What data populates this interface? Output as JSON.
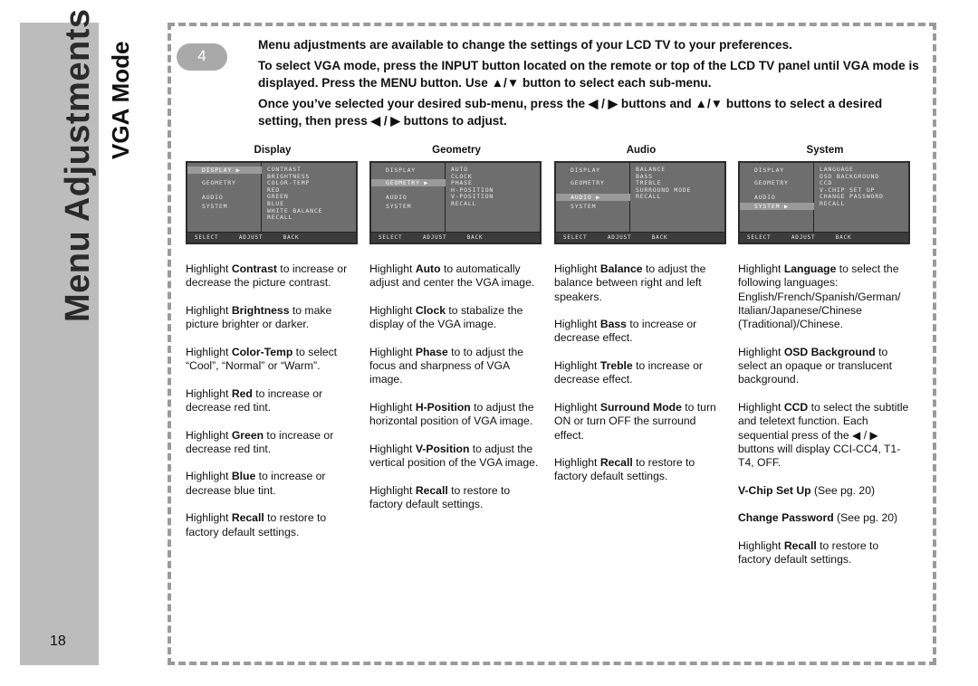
{
  "sidebar": {
    "title": "Menu Adjustments",
    "page_number": "18"
  },
  "section_title": "VGA Mode",
  "step": "4",
  "intro": [
    "Menu adjustments are available to change the settings of your LCD TV to your preferences.",
    "To select VGA mode, press the INPUT button located on the remote or top of the LCD TV panel until VGA mode is displayed. Press the MENU button. Use ▲/▼ button to select each sub-menu.",
    "Once you’ve selected your desired sub-menu, press the ◀ / ▶ buttons and ▲/▼ buttons to select a desired setting, then press ◀ / ▶ buttons to adjust."
  ],
  "osd_main": [
    "DISPLAY",
    "GEOMETRY",
    "AUDIO",
    "SYSTEM"
  ],
  "osd_footer": "SELECT ADJUST BACK",
  "columns": [
    {
      "title": "Display",
      "selected": 0,
      "items": [
        "CONTRAST",
        "BRIGHTNESS",
        "COLOR-TEMP",
        "RED",
        "GREEN",
        "BLUE",
        "WHITE BALANCE",
        "RECALL"
      ],
      "paras": [
        [
          "Highlight ",
          "Contrast",
          " to increase or decrease the picture contrast."
        ],
        [
          "Highlight ",
          "Brightness",
          " to make picture brighter or darker."
        ],
        [
          "Highlight ",
          "Color-Temp",
          " to select “Cool”, “Normal” or “Warm”."
        ],
        [
          "Highlight ",
          "Red",
          " to increase or decrease red tint."
        ],
        [
          "Highlight ",
          "Green",
          " to increase or decrease red tint."
        ],
        [
          "Highlight ",
          "Blue",
          " to increase or decrease blue tint."
        ],
        [
          "Highlight ",
          "Recall",
          " to restore to factory default settings."
        ]
      ]
    },
    {
      "title": "Geometry",
      "selected": 1,
      "items": [
        "AUTO",
        "CLOCK",
        "PHASE",
        "H-POSITION",
        "V-POSITION",
        "RECALL"
      ],
      "paras": [
        [
          "Highlight ",
          "Auto",
          " to automatically adjust and center the VGA image."
        ],
        [
          "Highlight ",
          "Clock",
          " to stabalize the display of the VGA image."
        ],
        [
          "Highlight ",
          "Phase",
          " to to adjust the focus and sharpness of VGA image."
        ],
        [
          "Highlight ",
          "H-Position",
          " to adjust the horizontal position of VGA image."
        ],
        [
          "Highlight ",
          "V-Position",
          " to adjust the vertical position of the VGA image."
        ],
        [
          "Highlight ",
          "Recall",
          " to restore to factory default settings."
        ]
      ]
    },
    {
      "title": "Audio",
      "selected": 2,
      "items": [
        "BALANCE",
        "BASS",
        "TREBLE",
        "SURROUND MODE",
        "RECALL"
      ],
      "paras": [
        [
          "Highlight ",
          "Balance",
          " to adjust the balance between right and left speakers."
        ],
        [
          "Highlight ",
          "Bass",
          " to increase or decrease effect."
        ],
        [
          "Highlight ",
          "Treble",
          " to increase or decrease effect."
        ],
        [
          "Highlight ",
          "Surround Mode",
          " to turn ON or turn OFF the surround effect."
        ],
        [
          "Highlight ",
          "Recall",
          " to restore to factory default settings."
        ]
      ]
    },
    {
      "title": "System",
      "selected": 3,
      "items": [
        "LANGUAGE",
        "OSD BACKGROUND",
        "CCD",
        "V-CHIP SET UP",
        "CHANGE PASSWORD",
        "RECALL"
      ],
      "paras": [
        [
          "Highlight ",
          "Language",
          " to select the following languages: English/French/Spanish/German/ Italian/Japanese/Chinese (Traditional)/Chinese."
        ],
        [
          "Highlight ",
          "OSD Background",
          " to select an opaque or translucent background."
        ],
        [
          "Highlight ",
          "CCD",
          " to select the subtitle and teletext function. Each sequential press of the ◀ / ▶ buttons will display CCI-CC4, T1-T4, OFF."
        ],
        [
          "",
          "V-Chip Set Up",
          "   (See pg. 20)"
        ],
        [
          "",
          "Change Password",
          "   (See pg. 20)"
        ],
        [
          "Highlight ",
          "Recall",
          " to restore to factory default settings."
        ]
      ]
    }
  ]
}
